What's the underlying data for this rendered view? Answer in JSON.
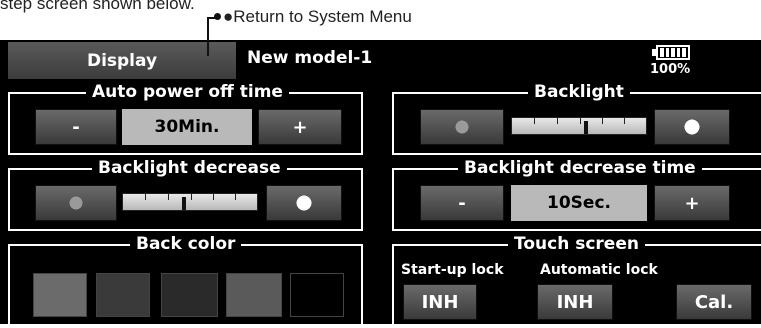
{
  "caption": {
    "text": "step screen shown below."
  },
  "annotation": {
    "label": "●Return to System Menu"
  },
  "header": {
    "tab_label": "Display",
    "model_name": "New model-1",
    "battery_percent": "100%",
    "battery_level": 1.0
  },
  "auto_power_off": {
    "title": "Auto power off time",
    "minus": "-",
    "value": "30Min.",
    "plus": "+"
  },
  "backlight": {
    "title": "Backlight",
    "level": 0.55
  },
  "backlight_decrease": {
    "title": "Backlight decrease",
    "level": 0.45
  },
  "backlight_decrease_time": {
    "title": "Backlight decrease time",
    "minus": "-",
    "value": "10Sec.",
    "plus": "+"
  },
  "back_color": {
    "title": "Back color",
    "swatches": [
      "#6b6b6b",
      "#3a3a3a",
      "#2a2a2a",
      "#5a5a5a",
      "#000000"
    ]
  },
  "touch_screen": {
    "title": "Touch screen",
    "startup_lock_label": "Start-up lock",
    "startup_lock_value": "INH",
    "auto_lock_label": "Automatic lock",
    "auto_lock_value": "INH",
    "calibrate_label": "Cal."
  }
}
